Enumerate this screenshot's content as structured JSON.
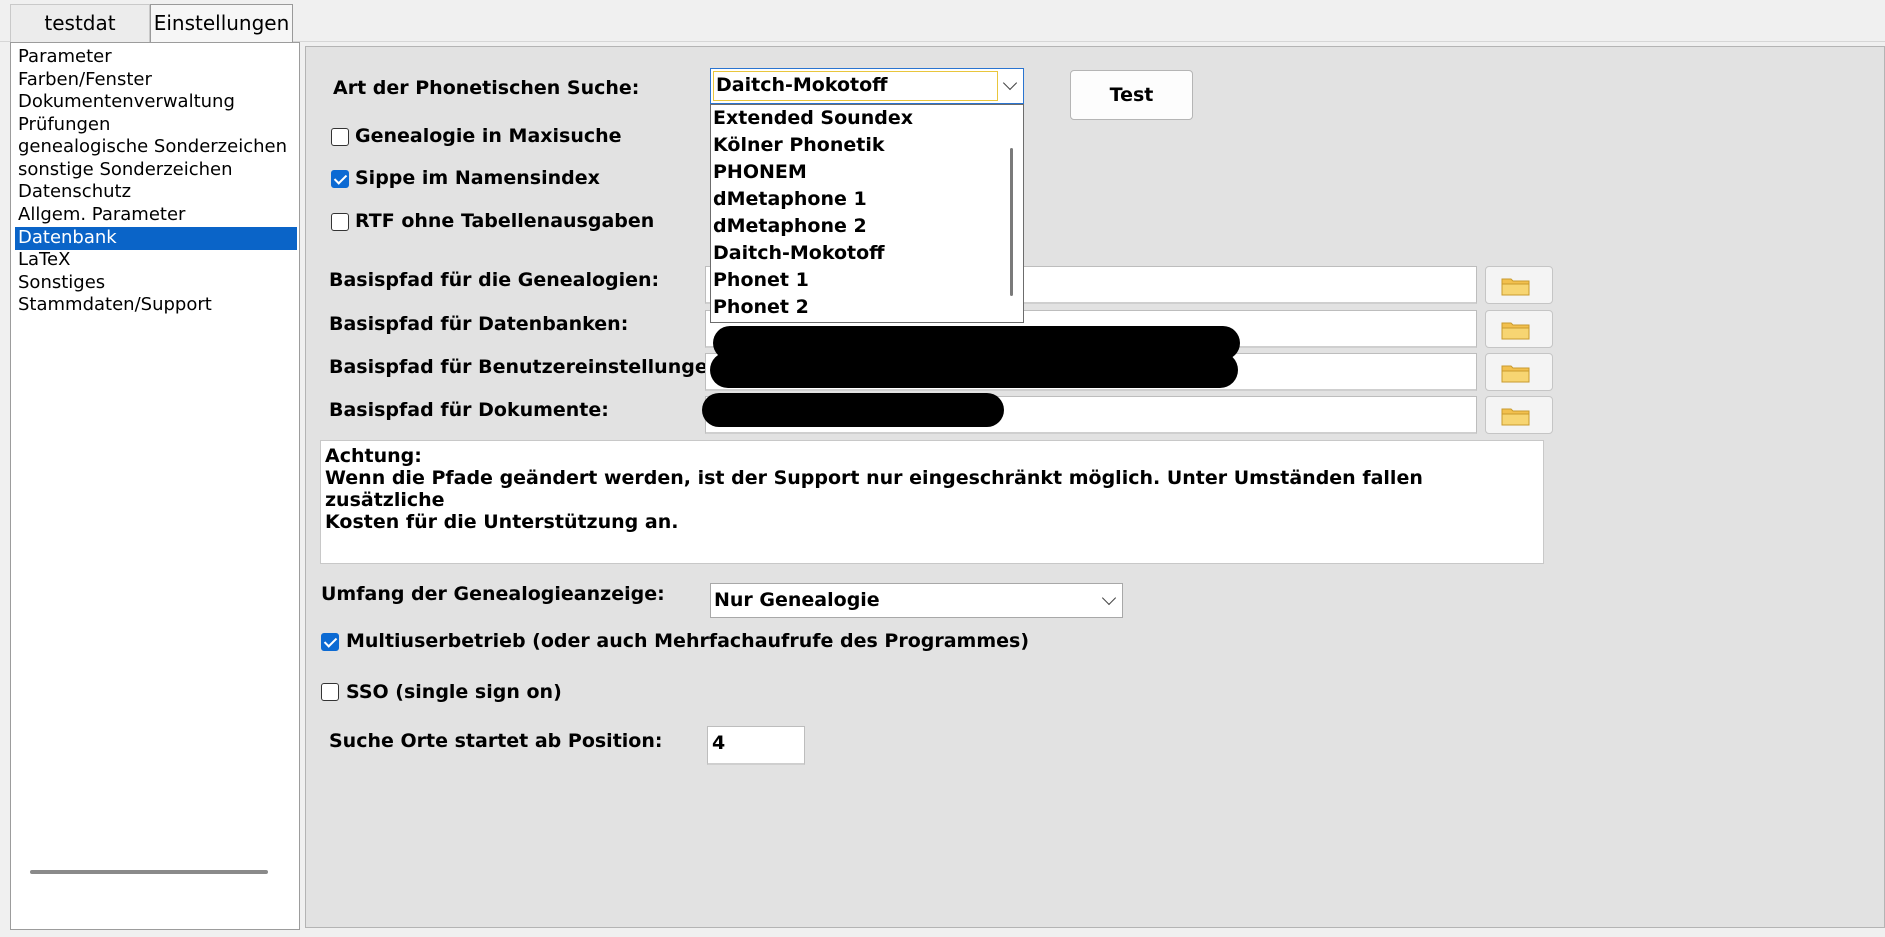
{
  "tabs": [
    "testdat",
    "Einstellungen"
  ],
  "nav": {
    "items": [
      "Parameter",
      "Farben/Fenster",
      "Dokumentenverwaltung",
      "Prüfungen",
      "genealogische Sonderzeichen",
      "sonstige Sonderzeichen",
      "Datenschutz",
      "Allgem. Parameter",
      "Datenbank",
      "LaTeX",
      "Sonstiges",
      "Stammdaten/Support"
    ],
    "selected": "Datenbank"
  },
  "phonetic": {
    "label": "Art der Phonetischen Suche:",
    "value": "Daitch-Mokotoff",
    "options": [
      "Extended Soundex",
      "Kölner Phonetik",
      "PHONEM",
      "dMetaphone 1",
      "dMetaphone 2",
      "Daitch-Mokotoff",
      "Phonet 1",
      "Phonet 2"
    ]
  },
  "test_button": "Test",
  "checkboxes": {
    "genealogie_maxisuche": {
      "label": "Genealogie in Maxisuche",
      "checked": false
    },
    "sippe_namensindex": {
      "label": "Sippe im Namensindex",
      "checked": true
    },
    "rtf_ohne": {
      "label": "RTF ohne Tabellenausgaben",
      "checked": false
    }
  },
  "paths": {
    "genealogien": {
      "label": "Basispfad für die Genealogien:",
      "value": ""
    },
    "datenbanken": {
      "label": "Basispfad für Datenbanken:",
      "value": ""
    },
    "benutzer": {
      "label": "Basispfad für Benutzereinstellungen:",
      "value": ""
    },
    "dokumente": {
      "label": "Basispfad für Dokumente:",
      "value": ""
    }
  },
  "note": "Achtung:\nWenn die Pfade geändert werden, ist der Support nur eingeschränkt möglich. Unter Umständen fallen zusätzliche\nKosten für die Unterstützung an.",
  "umfang": {
    "label": "Umfang der Genealogieanzeige:",
    "value": "Nur Genealogie"
  },
  "multiuser": {
    "label": "Multiuserbetrieb (oder auch Mehrfachaufrufe des Programmes)",
    "checked": true
  },
  "sso": {
    "label": "SSO (single sign on)",
    "checked": false
  },
  "suche_orte": {
    "label": "Suche Orte startet  ab Position:",
    "value": "4"
  },
  "colors": {
    "selection": "#0a64c8",
    "checkbox_on": "#0c6ad3",
    "panel_bg": "#e2e2e2"
  },
  "icons": {
    "folder": "folder-icon",
    "dropdown": "chevron-down-icon"
  }
}
